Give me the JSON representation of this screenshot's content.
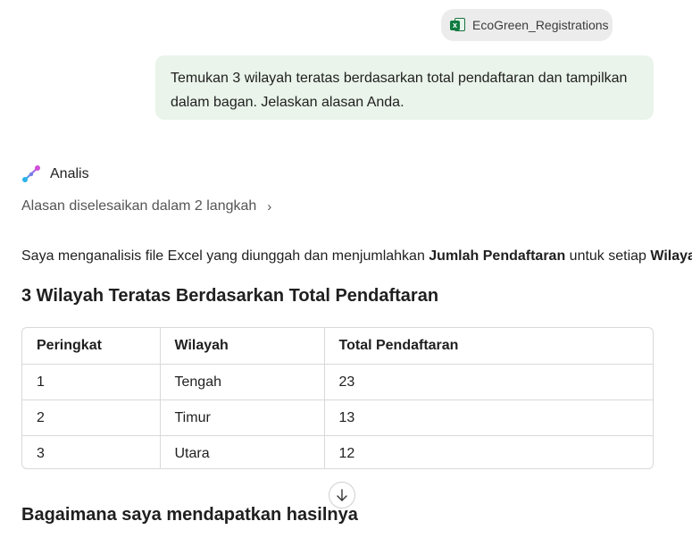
{
  "attachment": {
    "file_name": "EcoGreen_Registrations",
    "icon": "excel-file-icon"
  },
  "user_message": {
    "text": "Temukan 3 wilayah teratas berdasarkan total pendaftaran dan tampilkan dalam bagan. Jelaskan alasan Anda."
  },
  "assistant": {
    "label": "Analis",
    "icon": "analyst-sparkle-icon",
    "reasoning_text": "Alasan diselesaikan dalam 2 langkah",
    "reasoning_chevron": "›",
    "summary": {
      "part1": "Saya menganalisis file Excel yang diunggah dan menjumlahkan ",
      "bold1": "Jumlah Pendaftaran",
      "part2": " untuk setiap ",
      "bold2": "Wilayah",
      "part3": "."
    },
    "section_title": "3 Wilayah Teratas Berdasarkan Total Pendaftaran",
    "table": {
      "headers": [
        "Peringkat",
        "Wilayah",
        "Total Pendaftaran"
      ],
      "rows": [
        [
          "1",
          "Tengah",
          "23"
        ],
        [
          "2",
          "Timur",
          "13"
        ],
        [
          "3",
          "Utara",
          "12"
        ]
      ]
    },
    "next_section_title": "Bagaimana saya mendapatkan hasilnya"
  },
  "scroll_button": {
    "icon": "arrow-down-icon"
  }
}
